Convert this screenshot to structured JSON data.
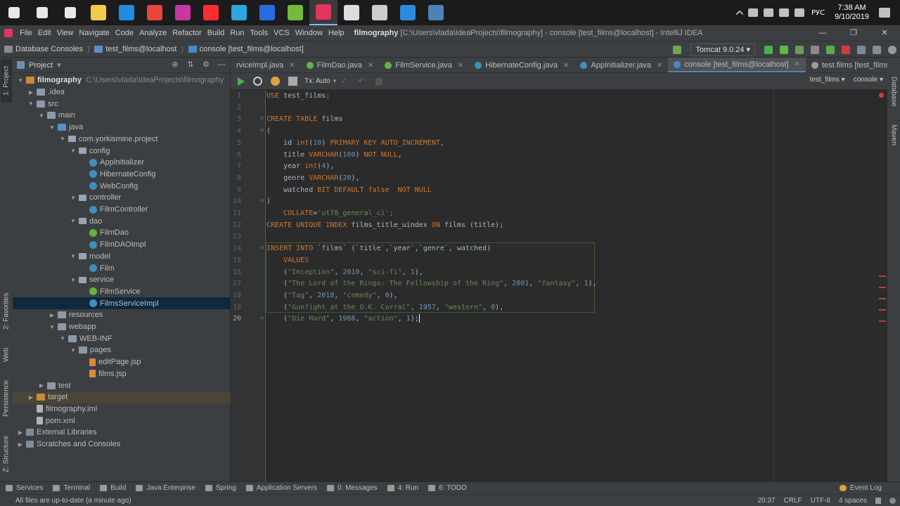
{
  "taskbar": {
    "icons": [
      {
        "name": "windows-start-icon",
        "color": "#ffffff"
      },
      {
        "name": "search-icon",
        "color": "#ffffff"
      },
      {
        "name": "task-view-icon",
        "color": "#ffffff"
      },
      {
        "name": "file-explorer-icon",
        "color": "#f2c94c"
      },
      {
        "name": "edge-icon",
        "color": "#1f8ce0"
      },
      {
        "name": "chrome-icon",
        "color": "#e8453c"
      },
      {
        "name": "jetbrains-toolbox-icon",
        "color": "#c837a3"
      },
      {
        "name": "yandex-browser-icon",
        "color": "#ff2d2d"
      },
      {
        "name": "telegram-icon",
        "color": "#2ea6e0"
      },
      {
        "name": "dropbox-icon",
        "color": "#2a6ae0"
      },
      {
        "name": "utorrent-icon",
        "color": "#76b83f"
      },
      {
        "name": "intellij-idea-icon",
        "color": "#e0365c"
      },
      {
        "name": "library-app-icon",
        "color": "#dddddd"
      },
      {
        "name": "settings-app-icon",
        "color": "#cccccc"
      },
      {
        "name": "vscode-icon",
        "color": "#2b8ae0"
      },
      {
        "name": "terminal-app-icon",
        "color": "#4c82b8"
      }
    ],
    "language": "РУС",
    "time": "7:38 AM",
    "date": "9/10/2019"
  },
  "menubar": {
    "items": [
      "File",
      "Edit",
      "View",
      "Navigate",
      "Code",
      "Analyze",
      "Refactor",
      "Build",
      "Run",
      "Tools",
      "VCS",
      "Window",
      "Help"
    ],
    "project_name": "filmography",
    "title_rest": "[C:\\Users\\vlada\\IdeaProjects\\filmography] - console [test_films@localhost] - IntelliJ IDEA"
  },
  "navbar": {
    "crumbs": [
      "Database Consoles",
      "test_films@localhost",
      "console [test_films@localhost]"
    ],
    "run_config": "Tomcat 9.0.24"
  },
  "left_tabs": [
    "1: Project",
    "2: Favorites",
    "Web",
    "Persistence",
    "Z: Structure"
  ],
  "right_tabs": [
    "Database",
    "Maven"
  ],
  "project_panel": {
    "title": "Project",
    "tree": [
      {
        "label": "filmography",
        "extra": "C:\\Users\\vlada\\IdeaProjects\\filmography",
        "bold": true
      },
      {
        "label": ".idea"
      },
      {
        "label": "src"
      },
      {
        "label": "main"
      },
      {
        "label": "java"
      },
      {
        "label": "com.yorkismine.project"
      },
      {
        "label": "config"
      },
      {
        "label": "AppInitializer"
      },
      {
        "label": "HibernateConfig"
      },
      {
        "label": "WebConfig"
      },
      {
        "label": "controller"
      },
      {
        "label": "FilmController"
      },
      {
        "label": "dao"
      },
      {
        "label": "FilmDao"
      },
      {
        "label": "FilmDAOImpl"
      },
      {
        "label": "model"
      },
      {
        "label": "Film"
      },
      {
        "label": "service"
      },
      {
        "label": "FilmService"
      },
      {
        "label": "FilmsServiceImpl"
      },
      {
        "label": "resources"
      },
      {
        "label": "webapp"
      },
      {
        "label": "WEB-INF"
      },
      {
        "label": "pages"
      },
      {
        "label": "editPage.jsp"
      },
      {
        "label": "films.jsp"
      },
      {
        "label": "test"
      },
      {
        "label": "target"
      },
      {
        "label": "filmography.iml"
      },
      {
        "label": "pom.xml"
      },
      {
        "label": "External Libraries"
      },
      {
        "label": "Scratches and Consoles"
      }
    ]
  },
  "tabs": [
    {
      "label": "rviceImpl.java",
      "color": "#3f8fbf"
    },
    {
      "label": "FilmDao.java",
      "color": "#62b543"
    },
    {
      "label": "FilmService.java",
      "color": "#62b543"
    },
    {
      "label": "HibernateConfig.java",
      "color": "#3f8fbf"
    },
    {
      "label": "AppInitializer.java",
      "color": "#3f8fbf"
    },
    {
      "label": "console [test_films@localhost]",
      "color": "#4a88c7"
    },
    {
      "label": "test.films [test_films@localhost]",
      "color": "#9a9a9a"
    }
  ],
  "editor_toolbar": {
    "tx_mode": "Tx: Auto",
    "schema": "test_films",
    "session": "console"
  },
  "code": {
    "line_numbers": [
      "1",
      "2",
      "3",
      "4",
      "5",
      "6",
      "7",
      "8",
      "9",
      "10",
      "11",
      "12",
      "13",
      "14",
      "15",
      "16",
      "17",
      "18",
      "19",
      "20"
    ],
    "current_line": "20",
    "lines": [
      [
        [
          "kw",
          "USE "
        ],
        [
          "ident",
          "test_films"
        ],
        [
          "kw",
          ";"
        ]
      ],
      [],
      [
        [
          "kw",
          "CREATE TABLE "
        ],
        [
          "ident",
          "films"
        ]
      ],
      [
        [
          "ident",
          "("
        ]
      ],
      [
        [
          "ident",
          "    id "
        ],
        [
          "kw",
          "int"
        ],
        [
          "ident",
          "("
        ],
        [
          "num",
          "10"
        ],
        [
          "ident",
          ") "
        ],
        [
          "kw",
          "PRIMARY KEY AUTO_INCREMENT"
        ],
        [
          "ident",
          ","
        ]
      ],
      [
        [
          "ident",
          "    title "
        ],
        [
          "kw",
          "VARCHAR"
        ],
        [
          "ident",
          "("
        ],
        [
          "num",
          "100"
        ],
        [
          "ident",
          ") "
        ],
        [
          "kw",
          "NOT NULL"
        ],
        [
          "ident",
          ","
        ]
      ],
      [
        [
          "ident",
          "    year "
        ],
        [
          "kw",
          "int"
        ],
        [
          "ident",
          "("
        ],
        [
          "num",
          "4"
        ],
        [
          "ident",
          "),"
        ]
      ],
      [
        [
          "ident",
          "    genre "
        ],
        [
          "kw",
          "VARCHAR"
        ],
        [
          "ident",
          "("
        ],
        [
          "num",
          "20"
        ],
        [
          "ident",
          "),"
        ]
      ],
      [
        [
          "ident",
          "    watched "
        ],
        [
          "kw",
          "BIT DEFAULT false  NOT NULL"
        ]
      ],
      [
        [
          "ident",
          ")"
        ]
      ],
      [
        [
          "ident",
          "    "
        ],
        [
          "kw",
          "COLLATE"
        ],
        [
          "ident",
          "="
        ],
        [
          "str",
          "'utf8_general_ci'"
        ],
        [
          "kw",
          ";"
        ]
      ],
      [
        [
          "kw",
          "CREATE UNIQUE INDEX "
        ],
        [
          "ident",
          "films_title_uindex "
        ],
        [
          "kw",
          "ON "
        ],
        [
          "ident",
          "films (title);"
        ]
      ],
      [],
      [
        [
          "kw",
          "INSERT INTO "
        ],
        [
          "ident",
          "`films` (`title`,`year`,`genre`, watched)"
        ]
      ],
      [
        [
          "ident",
          "    "
        ],
        [
          "kw",
          "VALUES"
        ]
      ],
      [
        [
          "ident",
          "    ("
        ],
        [
          "str",
          "\"Inception\""
        ],
        [
          "ident",
          ", "
        ],
        [
          "num",
          "2010"
        ],
        [
          "ident",
          ", "
        ],
        [
          "str",
          "\"sci-fi\""
        ],
        [
          "ident",
          ", "
        ],
        [
          "num",
          "1"
        ],
        [
          "ident",
          "),"
        ]
      ],
      [
        [
          "ident",
          "    ("
        ],
        [
          "str",
          "\"The Lord of the Rings: The Fellowship of the Ring\""
        ],
        [
          "ident",
          ", "
        ],
        [
          "num",
          "2001"
        ],
        [
          "ident",
          ", "
        ],
        [
          "str",
          "\"fantasy\""
        ],
        [
          "ident",
          ", "
        ],
        [
          "num",
          "1"
        ],
        [
          "ident",
          "),"
        ]
      ],
      [
        [
          "ident",
          "    ("
        ],
        [
          "str",
          "\"Tag\""
        ],
        [
          "ident",
          ", "
        ],
        [
          "num",
          "2018"
        ],
        [
          "ident",
          ", "
        ],
        [
          "str",
          "\"comedy\""
        ],
        [
          "ident",
          ", "
        ],
        [
          "num",
          "0"
        ],
        [
          "ident",
          "),"
        ]
      ],
      [
        [
          "ident",
          "    ("
        ],
        [
          "str",
          "\"Gunfight at the O.K. Corral\""
        ],
        [
          "ident",
          ", "
        ],
        [
          "num",
          "1957"
        ],
        [
          "ident",
          ", "
        ],
        [
          "str",
          "\"western\""
        ],
        [
          "ident",
          ", "
        ],
        [
          "num",
          "0"
        ],
        [
          "ident",
          "),"
        ]
      ],
      [
        [
          "ident",
          "    ("
        ],
        [
          "str",
          "\"Die Hard\""
        ],
        [
          "ident",
          ", "
        ],
        [
          "num",
          "1988"
        ],
        [
          "ident",
          ", "
        ],
        [
          "str",
          "\"action\""
        ],
        [
          "ident",
          ", "
        ],
        [
          "num",
          "1"
        ],
        [
          "ident",
          ");"
        ]
      ]
    ]
  },
  "bottom_tools": [
    "Services",
    "Terminal",
    "Build",
    "Java Enterprise",
    "Spring",
    "Application Servers",
    "0: Messages",
    "4: Run",
    "6: TODO"
  ],
  "event_log": "Event Log",
  "status": {
    "message": "All files are up-to-date (a minute ago)",
    "position": "20:37",
    "line_sep": "CRLF",
    "encoding": "UTF-8",
    "indent": "4 spaces"
  }
}
